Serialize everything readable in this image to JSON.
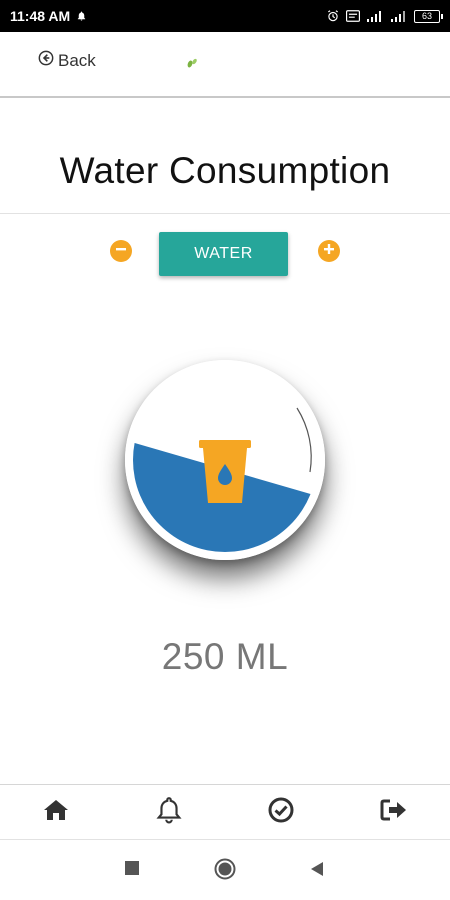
{
  "status_bar": {
    "time": "11:48 AM",
    "battery": "63"
  },
  "app_bar": {
    "back_label": "Back"
  },
  "page": {
    "title": "Water Consumption"
  },
  "controls": {
    "type_label": "WATER"
  },
  "gauge": {
    "fill_level": 0.45,
    "fill_color": "#2a77b6",
    "icon": "water-glass-icon",
    "icon_color": "#f5a623"
  },
  "amount": {
    "text": "250 ML"
  },
  "bottom_nav": {
    "items": [
      "home-icon",
      "bell-icon",
      "check-circle-icon",
      "logout-icon"
    ]
  },
  "colors": {
    "accent": "#26a69a",
    "orange": "#f5a623",
    "water": "#2a77b6"
  }
}
